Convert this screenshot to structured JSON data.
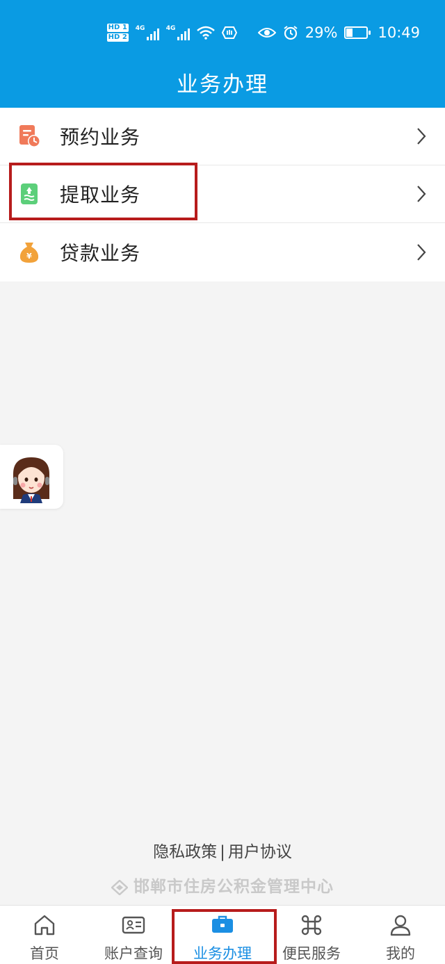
{
  "status_bar": {
    "hd1": "HD 1",
    "hd2": "HD 2",
    "net1": "4G",
    "net2": "4G",
    "battery_percent": "29%",
    "battery_level": 0.29,
    "time": "10:49",
    "icons": [
      "signal-icon",
      "signal-icon",
      "wifi-icon",
      "hand-icon",
      "eye-icon",
      "alarm-icon",
      "battery-icon"
    ]
  },
  "header": {
    "title": "业务办理"
  },
  "menu": {
    "items": [
      {
        "label": "预约业务",
        "icon": "appointment-icon",
        "color": "#f07a5a"
      },
      {
        "label": "提取业务",
        "icon": "withdraw-icon",
        "color": "#5ccf7a"
      },
      {
        "label": "贷款业务",
        "icon": "money-bag-icon",
        "color": "#f2a23a"
      }
    ]
  },
  "floating": {
    "icon": "customer-service-avatar"
  },
  "footer": {
    "privacy": "隐私政策",
    "separator": "|",
    "agreement": "用户协议",
    "org": "邯郸市住房公积金管理中心"
  },
  "bottom_nav": {
    "items": [
      {
        "label": "首页",
        "icon": "home-icon",
        "active": false
      },
      {
        "label": "账户查询",
        "icon": "id-card-icon",
        "active": false
      },
      {
        "label": "业务办理",
        "icon": "briefcase-icon",
        "active": true
      },
      {
        "label": "便民服务",
        "icon": "command-icon",
        "active": false
      },
      {
        "label": "我的",
        "icon": "user-icon",
        "active": false
      }
    ]
  },
  "colors": {
    "primary": "#0a9be3",
    "active_tab": "#1b8fe3",
    "highlight": "#b71c1c"
  }
}
